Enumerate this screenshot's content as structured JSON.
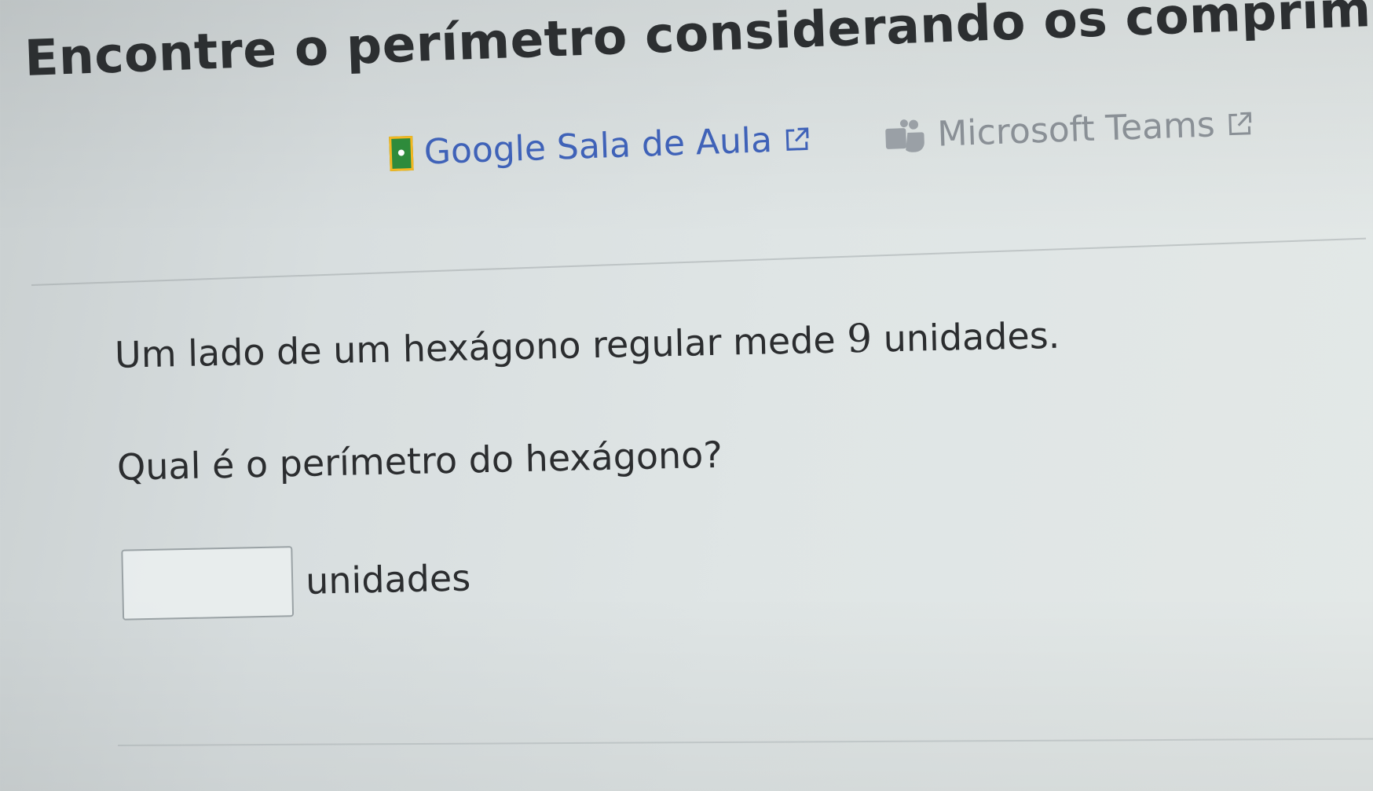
{
  "title": "Encontre o perímetro considerando os comprimentos",
  "share": {
    "google_label": "Google Sala de Aula",
    "teams_label": "Microsoft Teams",
    "google_icon": "google-classroom-icon",
    "teams_icon": "microsoft-teams-icon",
    "external_icon": "external-link-icon"
  },
  "problem": {
    "text_before": "Um lado de um hexágono regular mede ",
    "side_value": "9",
    "text_after": " unidades.",
    "question": "Qual é o perímetro do hexágono?"
  },
  "answer": {
    "value": "",
    "placeholder": "",
    "unit": "unidades"
  },
  "colors": {
    "google_link": "#3f62b8",
    "teams_link": "#8a9096",
    "text": "#2b2d2f"
  }
}
